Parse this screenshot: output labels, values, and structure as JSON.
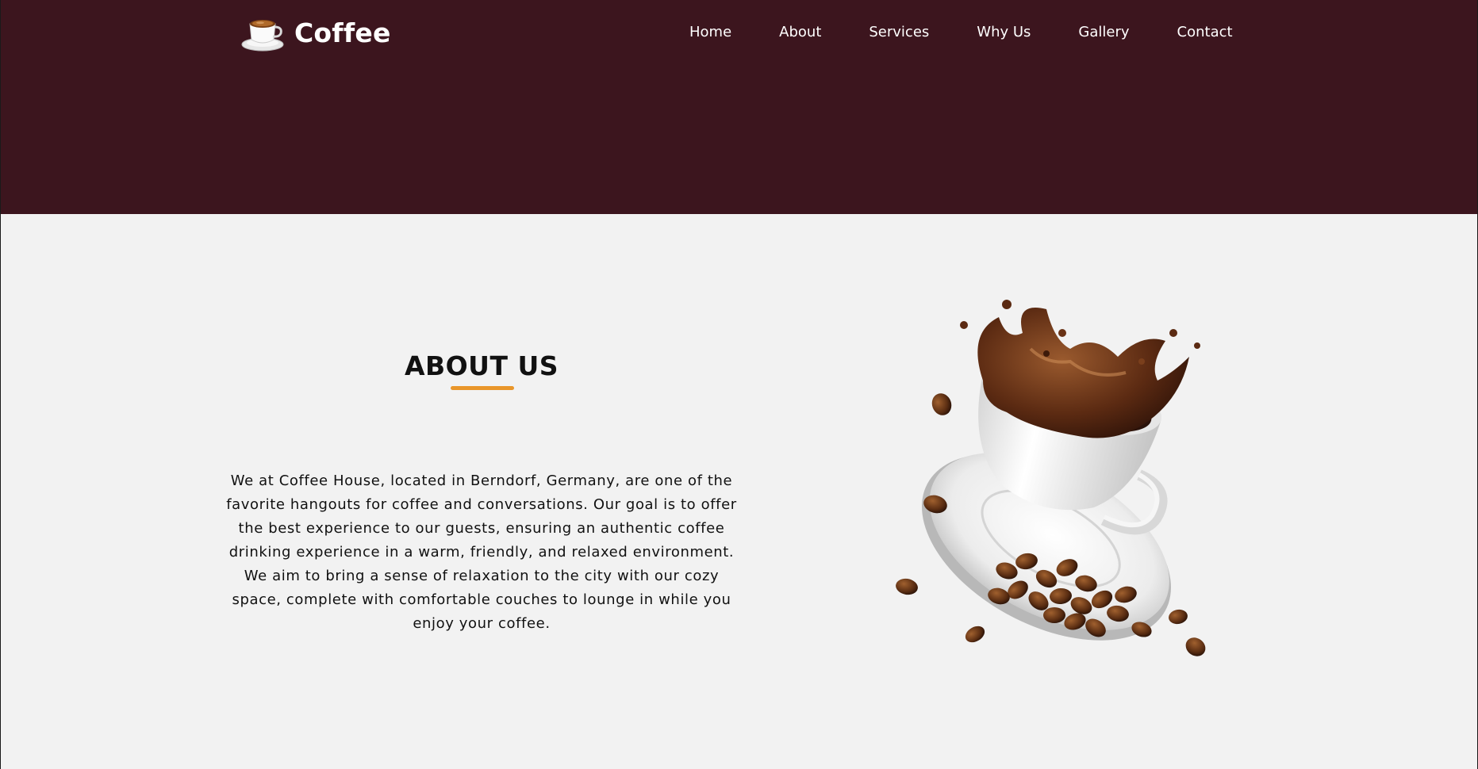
{
  "brand": {
    "name": "Coffee",
    "logo_icon": "coffee-cup-icon"
  },
  "nav": {
    "items": [
      {
        "label": "Home"
      },
      {
        "label": "About"
      },
      {
        "label": "Services"
      },
      {
        "label": "Why Us"
      },
      {
        "label": "Gallery"
      },
      {
        "label": "Contact"
      }
    ]
  },
  "about": {
    "title": "ABOUT US",
    "body": "We at Coffee House, located in Berndorf, Germany, are one of the favorite hangouts for coffee and conversations. Our goal is to offer the best experience to our guests, ensuring an authentic coffee drinking experience in a warm, friendly, and relaxed environment. We aim to bring a sense of relaxation to the city with our cozy space, complete with comfortable couches to lounge in while you enjoy your coffee.",
    "image": "coffee-splash-cup-with-beans"
  },
  "colors": {
    "header_bg": "#3c151e",
    "page_bg": "#f2f2f2",
    "accent": "#e9962a",
    "nav_text": "#ffffff",
    "body_text": "#111111"
  }
}
